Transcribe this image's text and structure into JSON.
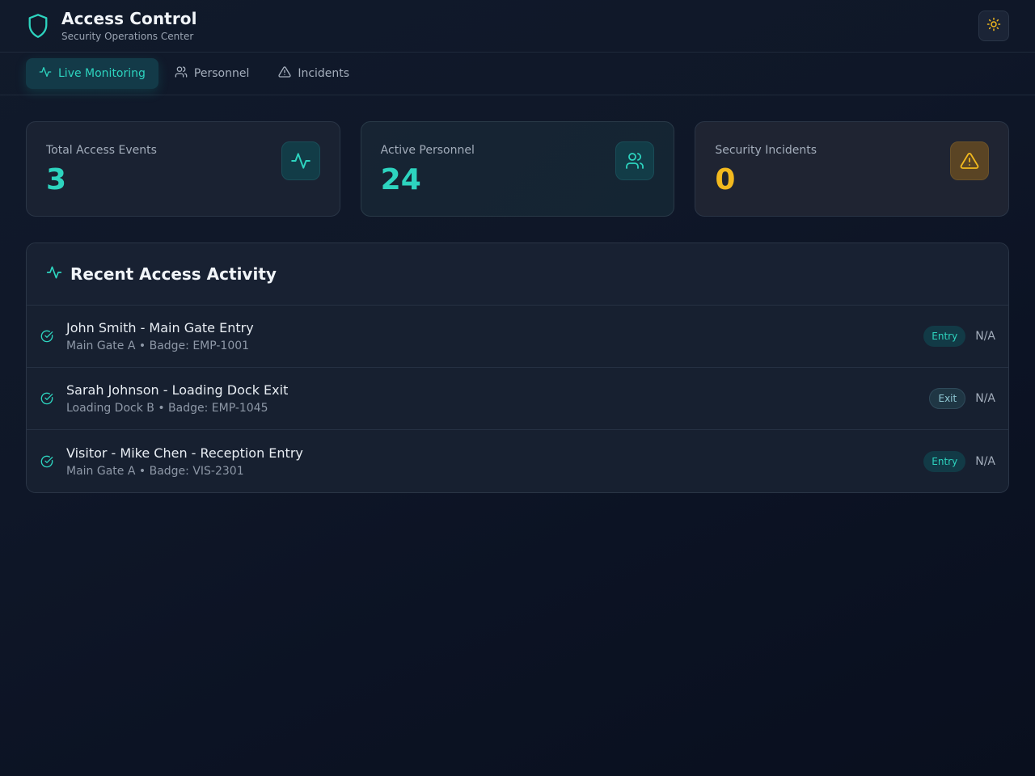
{
  "header": {
    "title": "Access Control",
    "subtitle": "Security Operations Center",
    "theme_toggle_icon": "sun-icon"
  },
  "nav": {
    "tabs": [
      {
        "label": "Live Monitoring",
        "icon": "activity-icon",
        "active": true
      },
      {
        "label": "Personnel",
        "icon": "users-icon",
        "active": false
      },
      {
        "label": "Incidents",
        "icon": "alert-triangle-icon",
        "active": false
      }
    ]
  },
  "stats": [
    {
      "label": "Total Access Events",
      "value": "3",
      "icon": "activity-icon",
      "color": "#2dd4bf"
    },
    {
      "label": "Active Personnel",
      "value": "24",
      "icon": "users-icon",
      "color": "#2dd4bf"
    },
    {
      "label": "Security Incidents",
      "value": "0",
      "icon": "alert-triangle-icon",
      "color": "#f2b91e"
    }
  ],
  "activity": {
    "title": "Recent Access Activity",
    "rows": [
      {
        "title": "John Smith - Main Gate Entry",
        "detail": "Main Gate A • Badge: EMP-1001",
        "type": "Entry",
        "time": "N/A"
      },
      {
        "title": "Sarah Johnson - Loading Dock Exit",
        "detail": "Loading Dock B • Badge: EMP-1045",
        "type": "Exit",
        "time": "N/A"
      },
      {
        "title": "Visitor - Mike Chen - Reception Entry",
        "detail": "Main Gate A • Badge: VIS-2301",
        "type": "Entry",
        "time": "N/A"
      }
    ]
  },
  "colors": {
    "accent": "#2dd4bf",
    "warning": "#f2b91e",
    "background": "#0f1728"
  }
}
